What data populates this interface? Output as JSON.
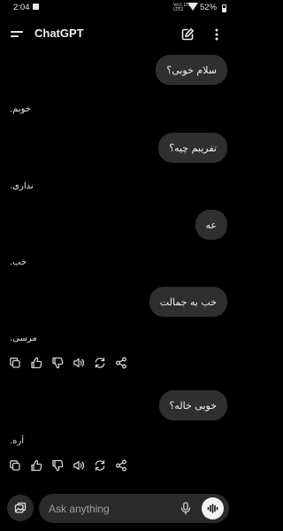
{
  "status_bar": {
    "time": "2:04",
    "network_lines": [
      "Vo)) LTE",
      "LTE2"
    ],
    "battery": "52%"
  },
  "header": {
    "title": "ChatGPT"
  },
  "messages": [
    {
      "role": "user",
      "text": "سلام خوبی؟"
    },
    {
      "role": "assistant",
      "text": "خوبم."
    },
    {
      "role": "user",
      "text": "تفریبم چیه؟"
    },
    {
      "role": "assistant",
      "text": "نداری."
    },
    {
      "role": "user",
      "text": "عه"
    },
    {
      "role": "assistant",
      "text": "خب."
    },
    {
      "role": "user",
      "text": "خب به جمالت"
    },
    {
      "role": "assistant",
      "text": "مرسی."
    },
    {
      "role": "user",
      "text": "خوبی خاله؟"
    },
    {
      "role": "assistant",
      "text": "آره."
    }
  ],
  "message_actions": [
    "copy-icon",
    "thumbs-up-icon",
    "thumbs-down-icon",
    "read-aloud-icon",
    "regenerate-icon",
    "share-icon"
  ],
  "composer": {
    "placeholder": "Ask anything"
  },
  "colors": {
    "background": "#000000",
    "bubble": "#2f2f2f",
    "composer": "#2b2b2b",
    "text": "#ececec",
    "voice_button": "#f2f2f2"
  }
}
